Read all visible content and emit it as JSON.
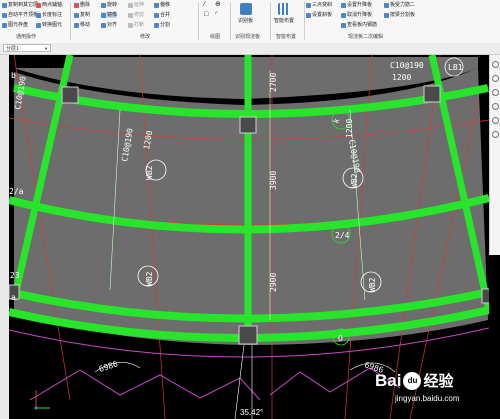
{
  "ribbon": {
    "group1": {
      "items": [
        "复制到其它层",
        "自动平齐顶板",
        "图元存盘",
        "两点辅轴",
        "长度标注",
        "转换图元"
      ],
      "label": "通用操作"
    },
    "group2": {
      "items": [
        "删除",
        "旋转",
        "延伸",
        "偏移",
        "复制",
        "镜像",
        "修剪",
        "合并",
        "移动",
        "对齐",
        "打断",
        "分割"
      ],
      "label": "修改"
    },
    "group3": {
      "label": "绘图"
    },
    "group4": {
      "button": "识别板",
      "label": "识别现浇板"
    },
    "group5": {
      "button": "智能布置",
      "label": "智能布置"
    },
    "group6": {
      "items": [
        "三点变斜",
        "设置升降板",
        "板受力筋二",
        "设置斜板",
        "取消升降板",
        "按梁分割板",
        "查看板内钢筋"
      ],
      "label": "现浇板二次编辑"
    }
  },
  "tabbar": {
    "selected": "分层1"
  },
  "drawing": {
    "labels": {
      "rebar1": "C10@190",
      "rebar1_len": "1200",
      "lb1": "LB1",
      "rebar2": "C10@190",
      "rebar2_len": "1200",
      "rebar3": "C10@190",
      "rebar3_len": "1200",
      "rebar4": "C10@190",
      "dim_2700": "2700",
      "dim_3900": "3900",
      "dim_2900": "2900",
      "wb2_a": "WB2",
      "wb2_b": "WB2",
      "wb2_c": "WB2",
      "wb2_d": "WB2",
      "axis_b": "b",
      "axis_2a": "2/a",
      "axis_23": "23",
      "axis_a": "a",
      "axis_24": "2/4",
      "axis_k": "k",
      "axis_o": "O",
      "arc_6986_a": "6986",
      "arc_6986_b": "6986",
      "angle": "35.42°"
    }
  },
  "watermark": {
    "brand": "Bai",
    "paw": "du",
    "jy": "经验",
    "url": "jingyan.baidu.com"
  },
  "colors": {
    "beam": "#27e52a",
    "slab": "#6d6d6d",
    "grid": "#d43a3a",
    "arc": "#c848c8"
  }
}
